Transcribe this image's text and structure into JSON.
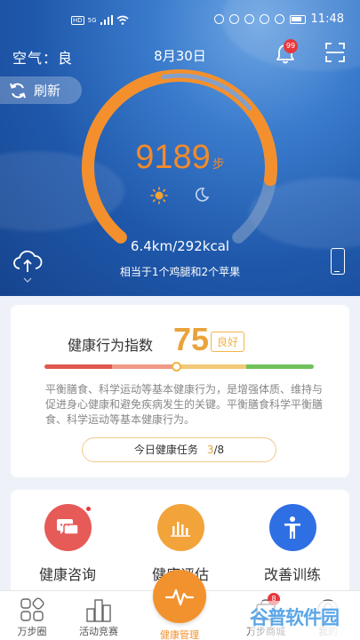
{
  "status_bar": {
    "time": "11:48",
    "network": "5G",
    "hd": "HD"
  },
  "header": {
    "air_quality": "空气：良",
    "date": "8月30日",
    "notification_count": "99"
  },
  "refresh_label": "刷新",
  "steps": {
    "value": "9189",
    "unit": "步",
    "progress": 0.85
  },
  "distance_calories": "6.4km/292kcal",
  "equivalent": "相当于1个鸡腿和2个苹果",
  "health_index": {
    "label": "健康行为指数",
    "score": "75",
    "rating": "良好",
    "marker_position": 0.49,
    "segment_colors": [
      "#e0584f",
      "#ef9a86",
      "#f3c977",
      "#6fc25b"
    ],
    "description": "平衡膳食、科学运动等基本健康行为，是增强体质、维持与促进身心健康和避免疾病发生的关键。平衡膳食科学平衡膳食、科学运动等基本健康行为。",
    "task_label": "今日健康任务",
    "task_done": "3",
    "task_total": "/8"
  },
  "features": [
    {
      "label": "健康咨询",
      "icon": "chat-icon",
      "color": "#e65a57"
    },
    {
      "label": "健康评估",
      "icon": "bar-chart-icon",
      "color": "#f2a33a"
    },
    {
      "label": "改善训练",
      "icon": "person-icon",
      "color": "#2f6fe4"
    }
  ],
  "nav": {
    "items": [
      "万步圈",
      "活动竞赛",
      "健康管理",
      "万步商城",
      "我的"
    ],
    "mall_badge": "8",
    "active_color": "#f2922e"
  },
  "watermark": "谷普软件园"
}
